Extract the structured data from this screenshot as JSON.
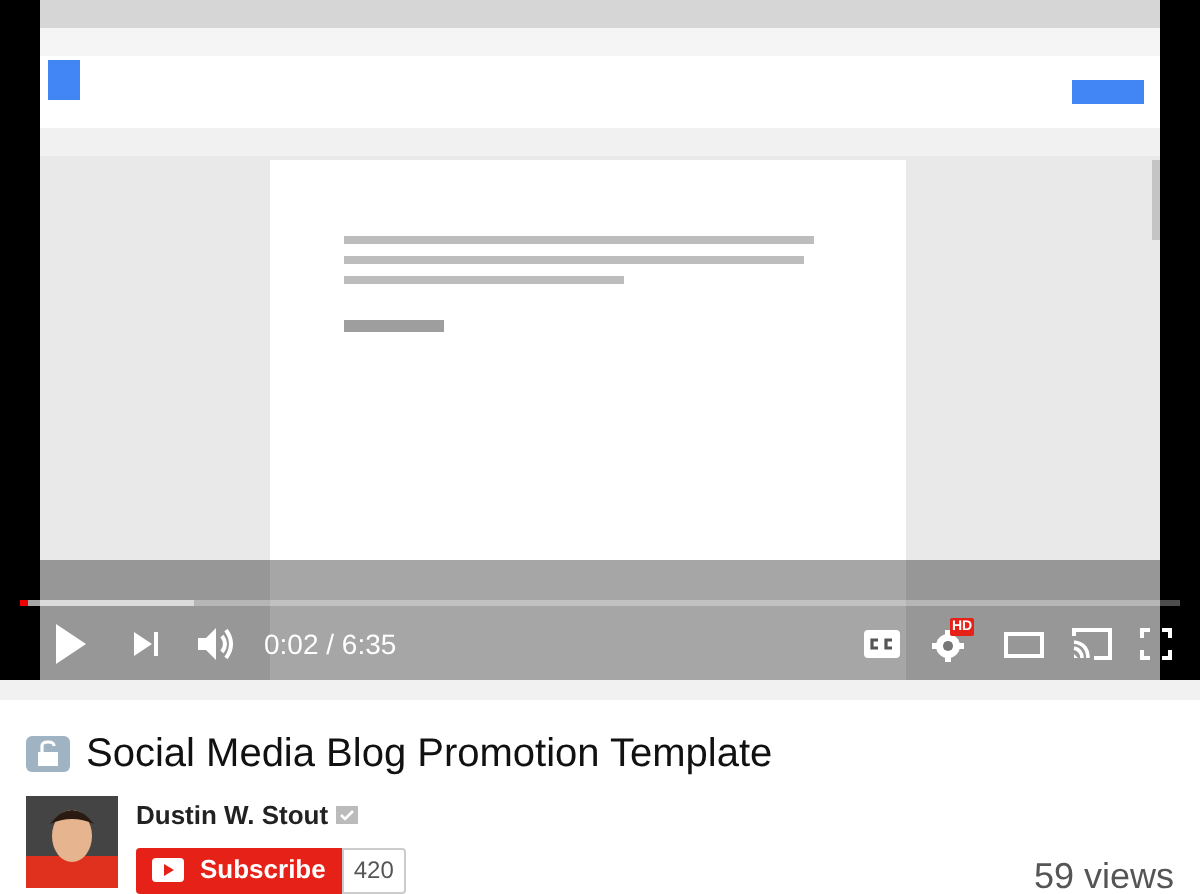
{
  "player": {
    "progress": {
      "level": 0.004
    },
    "buffered": {
      "level": 0.15
    },
    "time": "0:02 / 6:35",
    "hd_badge": "HD"
  },
  "video": {
    "title": "Social Media Blog Promotion Template",
    "private": true
  },
  "channel": {
    "name": "Dustin W. Stout",
    "verified": true,
    "subscribe_label": "Subscribe",
    "subscriber_count": "420"
  },
  "views": "59 views"
}
